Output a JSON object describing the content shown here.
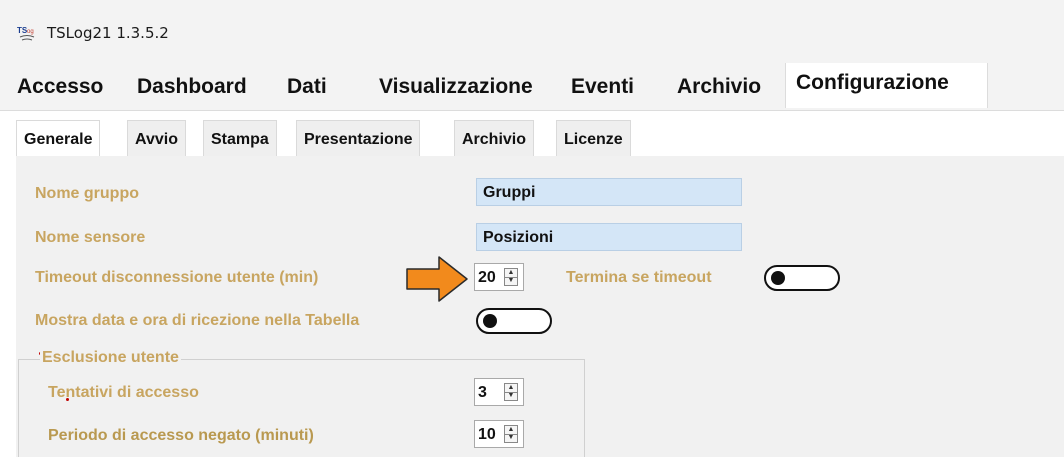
{
  "window": {
    "title": "TSLog21  1.3.5.2",
    "icon": "ts-app-icon"
  },
  "main_tabs": [
    {
      "label": "Accesso"
    },
    {
      "label": "Dashboard"
    },
    {
      "label": "Dati"
    },
    {
      "label": "Visualizzazione"
    },
    {
      "label": "Eventi"
    },
    {
      "label": "Archivio"
    },
    {
      "label": "Configurazione",
      "active": true
    }
  ],
  "sub_tabs": [
    {
      "label": "Generale",
      "active": true
    },
    {
      "label": "Avvio"
    },
    {
      "label": "Stampa"
    },
    {
      "label": "Presentazione"
    },
    {
      "label": "Archivio"
    },
    {
      "label": "Licenze"
    }
  ],
  "form": {
    "group_name_label": "Nome gruppo",
    "group_name_value": "Gruppi",
    "sensor_name_label": "Nome sensore",
    "sensor_name_value": "Posizioni",
    "timeout_label": "Timeout disconnessione utente (min)",
    "timeout_value": "20",
    "terminate_label": "Termina se timeout",
    "terminate_on": false,
    "show_date_label": "Mostra data e ora di ricezione nella Tabella",
    "show_date_on": false
  },
  "exclusion": {
    "legend": "Esclusione utente",
    "attempts_label": "Tentativi di accesso",
    "attempts_value": "3",
    "denied_period_label": "Periodo di accesso negato (minuti)",
    "denied_period_value": "10"
  },
  "colors": {
    "label_gold": "#c8a560",
    "field_blue": "#d4e6f7",
    "arrow_orange": "#f28a1c",
    "toggle_black": "#111111"
  },
  "annotation": {
    "icon": "orange-arrow-icon"
  }
}
